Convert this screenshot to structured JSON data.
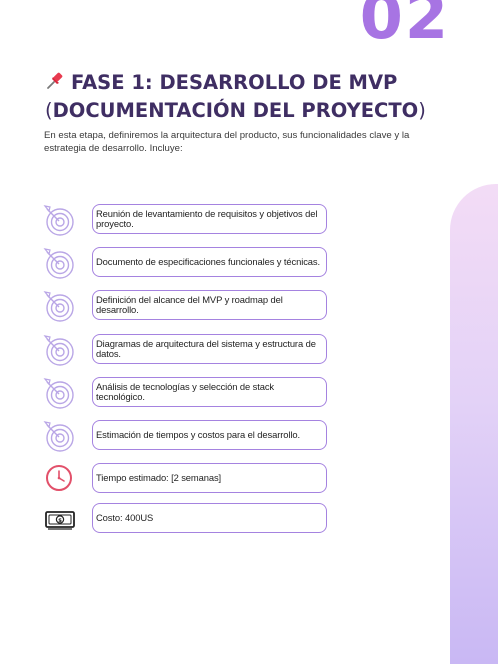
{
  "header": {
    "page_number": "02",
    "title_line1": "FASE 1: DESARROLLO DE MVP",
    "title_open_paren": "(",
    "title_line2": "DOCUMENTACIÓN DEL PROYECTO",
    "title_close_paren": ")",
    "pin_icon": "pushpin-icon",
    "intro": "En esta etapa, definiremos la arquitectura del producto, sus funcionalidades clave y la estrategia de desarrollo. Incluye:"
  },
  "items": [
    {
      "icon": "target-icon",
      "text": "Reunión de levantamiento de requisitos y objetivos del proyecto."
    },
    {
      "icon": "target-icon",
      "text": "Documento de especificaciones funcionales y técnicas."
    },
    {
      "icon": "target-icon",
      "text": "Definición del alcance del MVP y roadmap del desarrollo."
    },
    {
      "icon": "target-icon",
      "text": "Diagramas de arquitectura del sistema y estructura de datos."
    },
    {
      "icon": "target-icon",
      "text": "Análisis de tecnologías y selección de stack tecnológico."
    },
    {
      "icon": "target-icon",
      "text": "Estimación de tiempos y costos para el desarrollo."
    },
    {
      "icon": "clock-icon",
      "text": "Tiempo estimado: [2 semanas]"
    },
    {
      "icon": "money-icon",
      "text": "Costo: 400US"
    }
  ],
  "colors": {
    "accent": "#a774e3",
    "title": "#3f2e63",
    "border": "#a583e0",
    "clock": "#e2506a"
  }
}
